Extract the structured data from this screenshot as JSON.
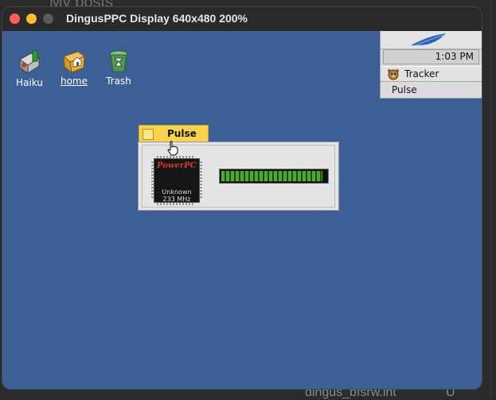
{
  "background": {
    "heading_text": "My posts",
    "footer_text": "dingus_bfsrw.int",
    "footer_right_text": "U"
  },
  "window": {
    "title": "DingusPPC Display 640x480 200%"
  },
  "desktop": {
    "color": "#3c5f96",
    "icons": [
      {
        "label": "Haiku",
        "icon": "haiku-drive-icon"
      },
      {
        "label": "home",
        "icon": "home-folder-icon"
      },
      {
        "label": "Trash",
        "icon": "trash-icon"
      }
    ]
  },
  "deskbar": {
    "clock": "1:03 PM",
    "tracker_label": "Tracker",
    "pulse_label": "Pulse"
  },
  "pulse_window": {
    "title": "Pulse",
    "cpu_brand": "PowerPC",
    "cpu_model": "Unknown",
    "cpu_speed": "233 MHz",
    "cpu_load_fraction": 0.96,
    "bar_color": "#4fa833",
    "tab_color": "#f9d34c"
  }
}
